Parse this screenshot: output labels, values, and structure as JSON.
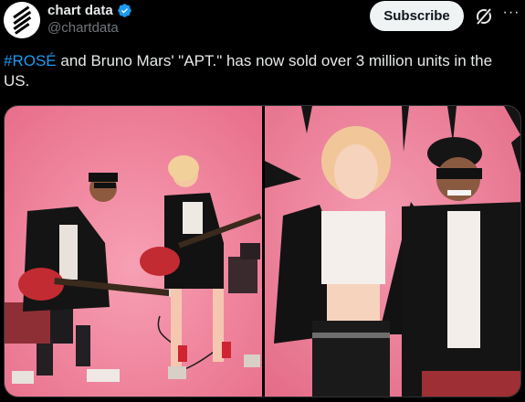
{
  "author": {
    "display_name": "chart data",
    "handle": "@chartdata",
    "avatar_icon": "chart-data-logo-icon",
    "verified_icon": "verified-badge-icon"
  },
  "actions": {
    "subscribe_label": "Subscribe",
    "grok_icon": "grok-icon",
    "more_icon": "more-icon",
    "more_glyph": "···"
  },
  "tweet": {
    "hashtag": "#ROSÉ",
    "text": " and Bruno Mars' \"APT.\" has now sold over 3 million units in the US."
  },
  "media": {
    "photos": [
      {
        "icon": "photo-icon",
        "description_icon": "left-photo"
      },
      {
        "icon": "photo-icon",
        "description_icon": "right-photo"
      }
    ]
  },
  "colors": {
    "accent": "#1d9bf0",
    "background": "#000000",
    "text": "#e7e9ea",
    "muted": "#71767b",
    "photo_pink": "#f07896"
  }
}
